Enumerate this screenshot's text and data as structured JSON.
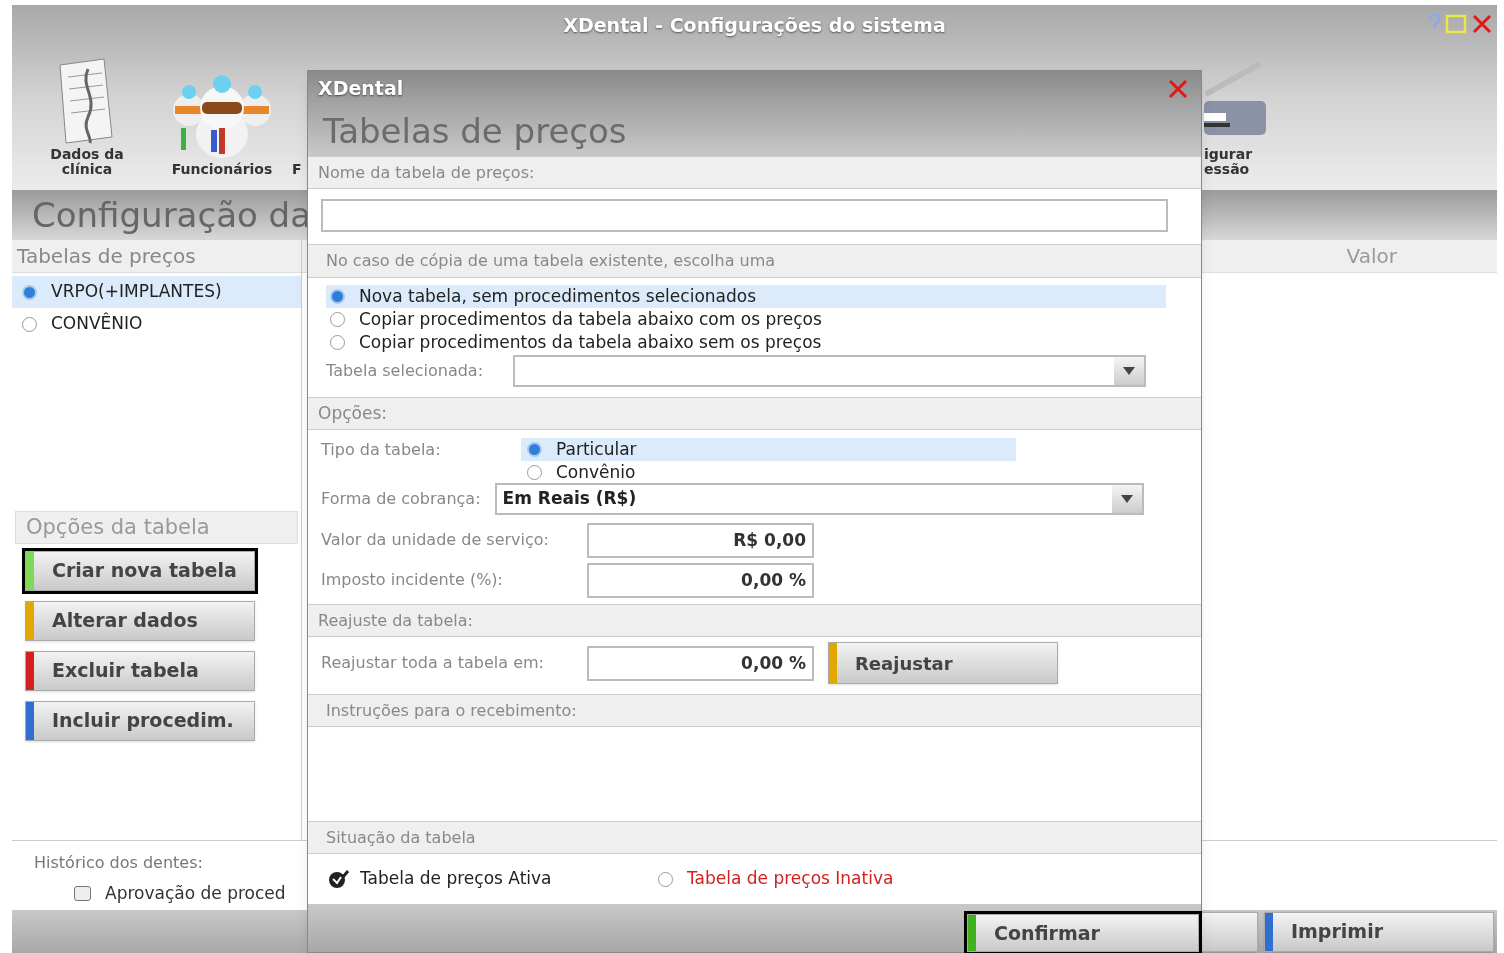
{
  "window": {
    "title": "XDental - Configurações do sistema"
  },
  "toolbar": [
    {
      "label": "Dados da\nclínica",
      "kind": "document"
    },
    {
      "label": "Funcionários",
      "kind": "people"
    },
    {
      "label": "F",
      "kind": "cut"
    },
    {
      "label": "igurar\nessão",
      "kind": "printer"
    }
  ],
  "page_title": "Configuração da",
  "price_tables": {
    "header": "Tabelas de preços",
    "items": [
      {
        "label": "VRPO(+IMPLANTES)",
        "selected": true
      },
      {
        "label": "CONVÊNIO",
        "selected": false
      }
    ]
  },
  "value_column": "Valor",
  "table_options": {
    "header": "Opções da tabela",
    "buttons": [
      {
        "label": "Criar nova tabela",
        "color": "#7ed957",
        "highlighted": true
      },
      {
        "label": "Alterar dados",
        "color": "#e0a800",
        "highlighted": false
      },
      {
        "label": "Excluir tabela",
        "color": "#d42020",
        "highlighted": false
      },
      {
        "label": "Incluir procedim.",
        "color": "#2f6fd0",
        "highlighted": false
      }
    ]
  },
  "history": {
    "label": "Histórico dos dentes:",
    "checkbox": {
      "label": "Aprovação de proced",
      "checked": false
    }
  },
  "bottom_buttons": [
    {
      "color": "#d0d0d0"
    },
    {
      "label": "Imprimir",
      "color": "#2f6fd0"
    }
  ],
  "dialog": {
    "title": "XDental",
    "heading": "Tabelas de preços",
    "name_section": "Nome da tabela de preços:",
    "copy_section": "No caso de cópia de uma tabela existente, escolha uma",
    "copy_options": [
      {
        "label": "Nova tabela, sem procedimentos selecionados",
        "selected": true
      },
      {
        "label": "Copiar procedimentos da tabela abaixo com os preços",
        "selected": false
      },
      {
        "label": "Copiar procedimentos da tabela abaixo sem os preços",
        "selected": false
      }
    ],
    "selected_table_label": "Tabela selecionada:",
    "options_section": "Opções:",
    "table_type_label": "Tipo da tabela:",
    "table_types": [
      {
        "label": "Particular",
        "selected": true
      },
      {
        "label": "Convênio",
        "selected": false
      }
    ],
    "billing_label": "Forma de cobrança:",
    "billing_value": "Em Reais (R$)",
    "unit_value_label": "Valor da unidade de serviço:",
    "unit_value": "R$ 0,00",
    "tax_label": "Imposto incidente (%):",
    "tax_value": "0,00 %",
    "adjust_section": "Reajuste da tabela:",
    "adjust_label": "Reajustar toda a tabela em:",
    "adjust_value": "0,00 %",
    "adjust_button": {
      "label": "Reajustar",
      "color": "#e0a800"
    },
    "instructions_section": "Instruções para o recebimento:",
    "status_section": "Situação da tabela",
    "status_active": {
      "label": "Tabela de preços Ativa",
      "checked": true
    },
    "status_inactive": {
      "label": "Tabela de preços Inativa",
      "selected": false
    },
    "confirm_button": {
      "label": "Confirmar",
      "color": "#3fb21d",
      "highlighted": true
    }
  }
}
